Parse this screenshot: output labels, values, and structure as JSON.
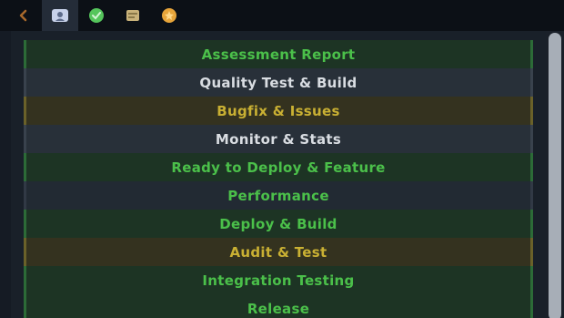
{
  "toolbar": {
    "buttons": [
      {
        "icon": "back-icon",
        "color": "#a8692c"
      },
      {
        "icon": "user-icon",
        "color": "#c8d2ea"
      },
      {
        "icon": "shield-icon",
        "color": "#55c55c"
      },
      {
        "icon": "document-icon",
        "color": "#c9b27a"
      },
      {
        "icon": "star-icon",
        "color": "#e8a53a"
      }
    ]
  },
  "list": {
    "items": [
      {
        "label": "Assessment Report",
        "tone": "green"
      },
      {
        "label": "Quality Test & Build",
        "tone": "dark"
      },
      {
        "label": "Bugfix & Issues",
        "tone": "gold"
      },
      {
        "label": "Monitor & Stats",
        "tone": "dark"
      },
      {
        "label": "Ready to Deploy & Feature",
        "tone": "green"
      },
      {
        "label": "Performance",
        "tone": "dim"
      },
      {
        "label": "Deploy & Build",
        "tone": "green"
      },
      {
        "label": "Audit & Test",
        "tone": "gold"
      },
      {
        "label": "Integration Testing",
        "tone": "green"
      },
      {
        "label": "Release",
        "tone": "green"
      }
    ]
  }
}
